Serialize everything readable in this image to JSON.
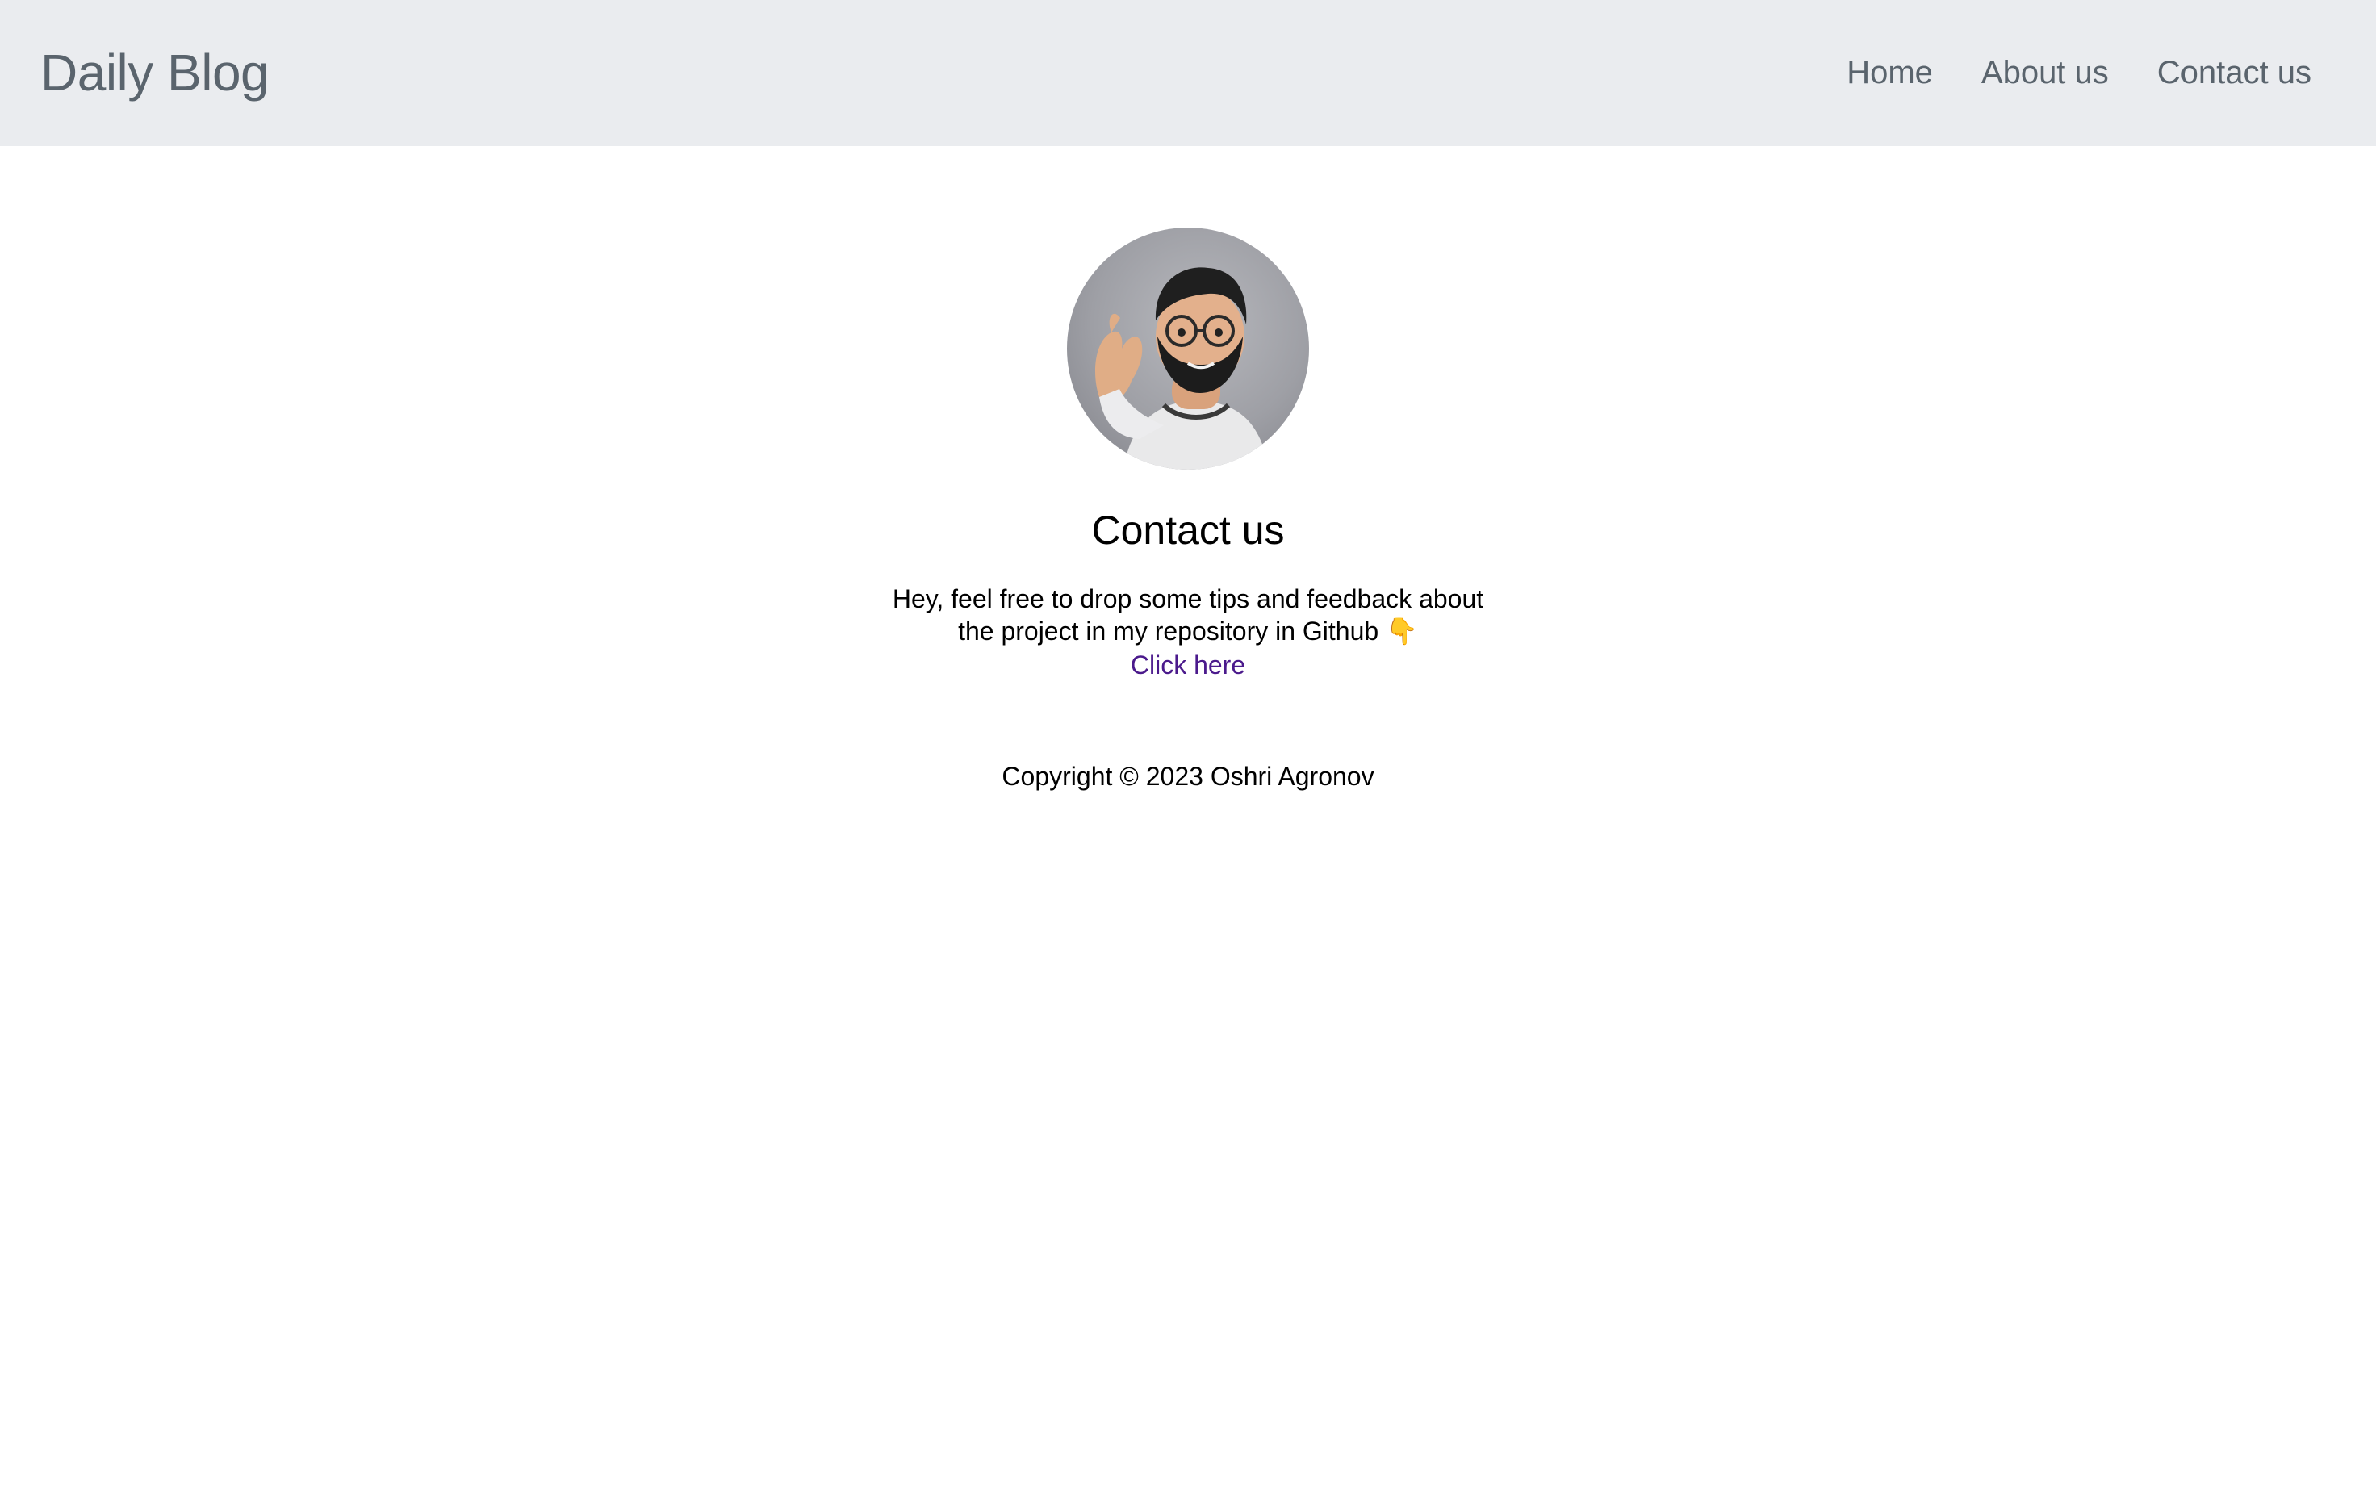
{
  "navbar": {
    "brand": "Daily Blog",
    "links": [
      "Home",
      "About us",
      "Contact us"
    ]
  },
  "avatar": {
    "icon": "memoji-avatar-icon"
  },
  "contact": {
    "title": "Contact us",
    "message_line1": "Hey, feel free to drop some tips and feedback about",
    "message_line2": "the project in my repository in Github 👇",
    "link_text": "Click here"
  },
  "footer": {
    "copyright": "Copyright © 2023 Oshri Agronov"
  },
  "colors": {
    "navbar_bg": "#eaecef",
    "nav_text": "#5a646d",
    "link": "#4b1a8c"
  }
}
